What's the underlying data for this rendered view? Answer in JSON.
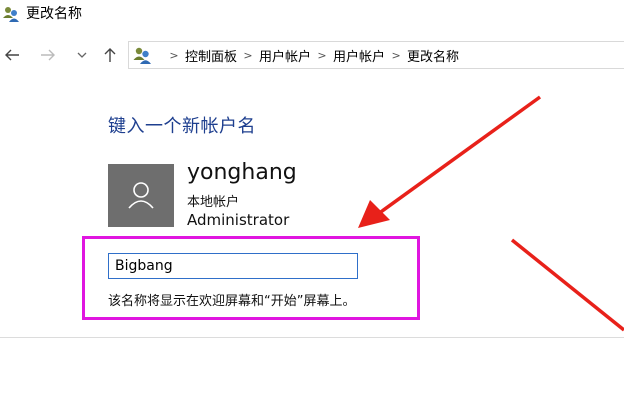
{
  "window": {
    "title": "更改名称"
  },
  "nav": {
    "back_icon": "back-arrow-icon",
    "forward_icon": "forward-arrow-icon",
    "recent_icon": "chevron-down-icon",
    "up_icon": "up-arrow-icon"
  },
  "breadcrumb": {
    "items": [
      "控制面板",
      "用户帐户",
      "用户帐户",
      "更改名称"
    ],
    "separator": ">"
  },
  "content": {
    "heading": "键入一个新帐户名",
    "user": {
      "name": "yonghang",
      "type": "本地帐户",
      "role": "Administrator"
    },
    "name_input": {
      "value": "Bigbang"
    },
    "hint": "该名称将显示在欢迎屏幕和“开始”屏幕上。"
  },
  "colors": {
    "heading": "#1e3f8f",
    "highlight": "#e016e0",
    "arrow": "#e8211a",
    "avatar_bg": "#6e6e6e",
    "input_border": "#2f6fc9"
  }
}
